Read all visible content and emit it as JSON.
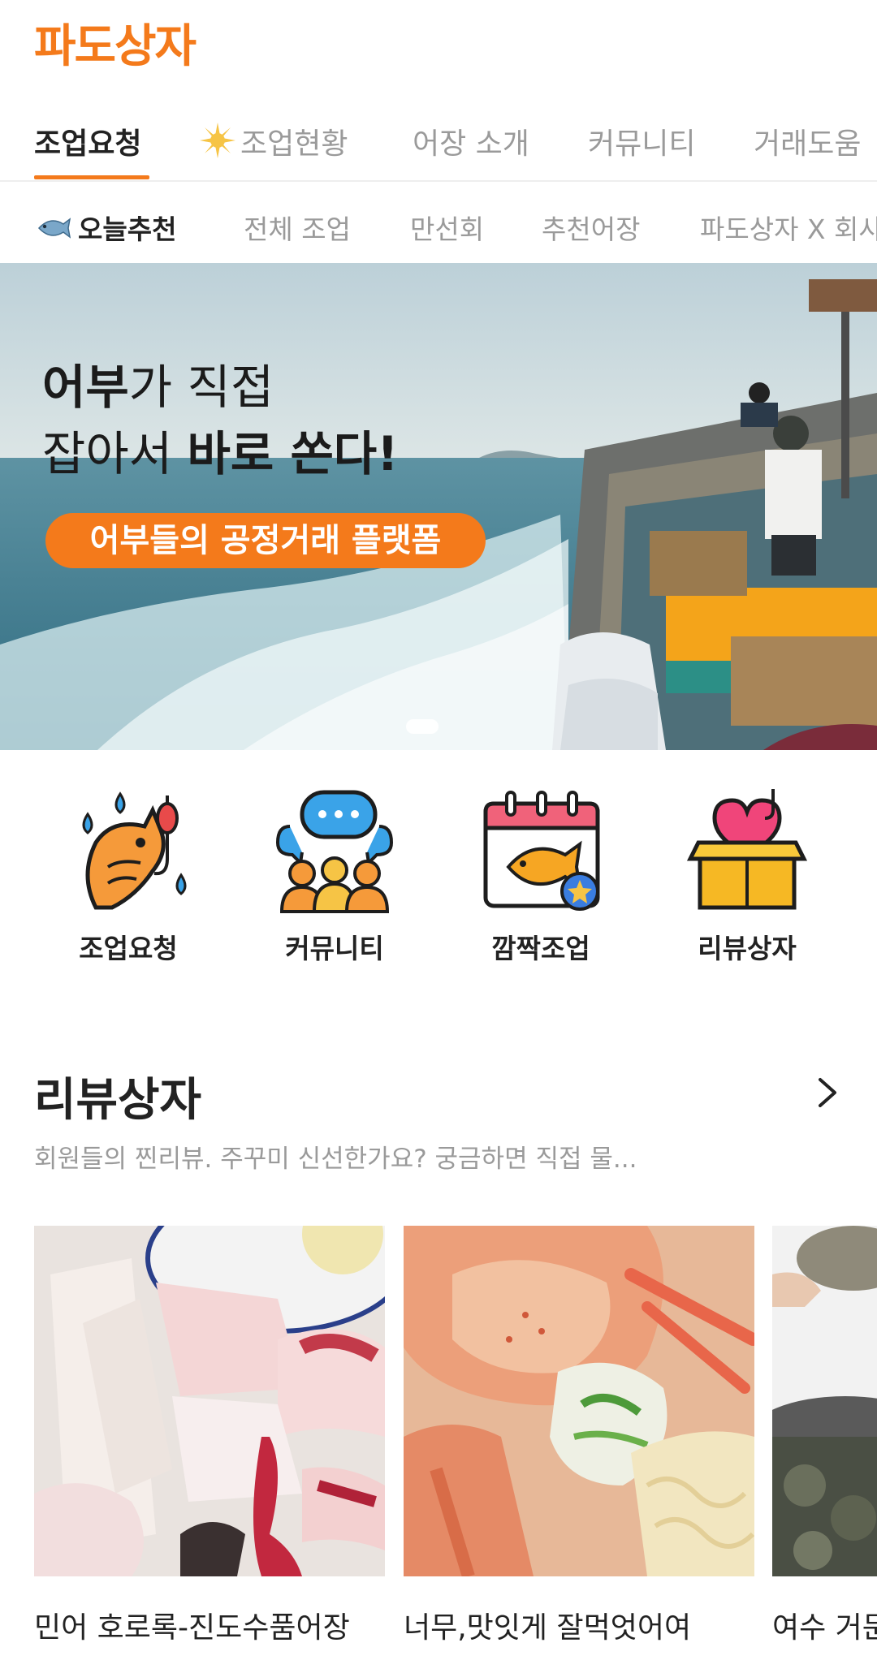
{
  "app": {
    "logo": "파도상자",
    "brand_color": "#f47a1b"
  },
  "main_tabs": [
    {
      "label": "조업요청",
      "active": true
    },
    {
      "label": "조업현황",
      "icon": "sparkle-icon"
    },
    {
      "label": "어장 소개"
    },
    {
      "label": "커뮤니티"
    },
    {
      "label": "거래도움"
    }
  ],
  "sub_tabs": [
    {
      "label": "오늘추천",
      "active": true,
      "icon": "fish-icon"
    },
    {
      "label": "전체 조업"
    },
    {
      "label": "만선회"
    },
    {
      "label": "추천어장"
    },
    {
      "label": "파도상자 X 회사"
    }
  ],
  "banner": {
    "line1_bold": "어부",
    "line1_rest": "가 직접",
    "line2_normal": "잡아서 ",
    "line2_bold": "바로 쏜다!",
    "pill": "어부들의 공정거래 플랫폼"
  },
  "quick_menu": [
    {
      "label": "조업요청",
      "icon": "fishing-icon"
    },
    {
      "label": "커뮤니티",
      "icon": "community-icon"
    },
    {
      "label": "깜짝조업",
      "icon": "calendar-fish-icon"
    },
    {
      "label": "리뷰상자",
      "icon": "heart-box-icon"
    }
  ],
  "review_section": {
    "title": "리뷰상자",
    "desc": "회원들의 찐리뷰. 주꾸미 신선한가요? 궁금하면 직접 물...",
    "cards": [
      {
        "title": "민어 호로록-진도수품어장"
      },
      {
        "title": "너무,맛잇게 잘먹엇어여"
      },
      {
        "title": "여수 거문"
      }
    ]
  }
}
